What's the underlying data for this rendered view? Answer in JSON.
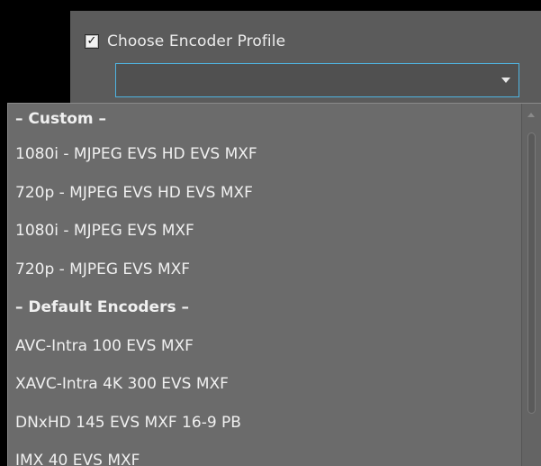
{
  "encoder": {
    "checkbox_checked": true,
    "checkbox_label": "Choose Encoder Profile",
    "selected_value": "",
    "accent_color": "#4fb3e0"
  },
  "dropdown": {
    "items": [
      {
        "label": "– Custom –",
        "is_header": true
      },
      {
        "label": "1080i - MJPEG EVS HD EVS MXF",
        "is_header": false
      },
      {
        "label": "720p - MJPEG EVS HD EVS MXF",
        "is_header": false
      },
      {
        "label": "1080i - MJPEG EVS MXF",
        "is_header": false
      },
      {
        "label": "720p - MJPEG EVS MXF",
        "is_header": false
      },
      {
        "label": "– Default Encoders –",
        "is_header": true
      },
      {
        "label": "AVC-Intra 100 EVS MXF",
        "is_header": false
      },
      {
        "label": "XAVC-Intra 4K 300 EVS MXF",
        "is_header": false
      },
      {
        "label": "DNxHD 145 EVS MXF 16-9 PB",
        "is_header": false
      },
      {
        "label": "IMX 40 EVS MXF",
        "is_header": false
      }
    ]
  },
  "icons": {
    "checkbox": "checkmark-icon",
    "combo_arrow": "chevron-down-icon",
    "scroll_up": "arrow-up-icon"
  }
}
